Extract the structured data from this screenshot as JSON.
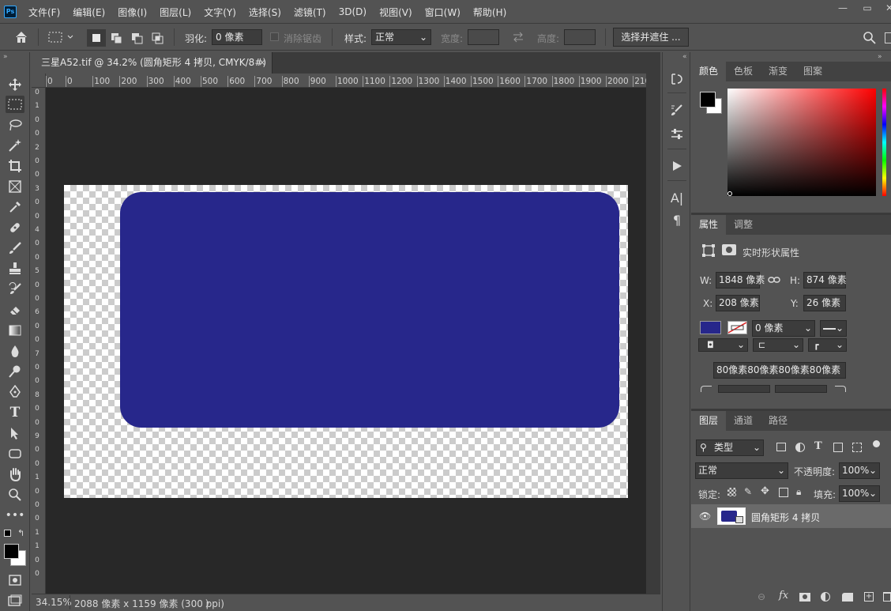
{
  "app": {
    "logo": "Ps"
  },
  "menu": [
    "文件(F)",
    "编辑(E)",
    "图像(I)",
    "图层(L)",
    "文字(Y)",
    "选择(S)",
    "滤镜(T)",
    "3D(D)",
    "视图(V)",
    "窗口(W)",
    "帮助(H)"
  ],
  "options": {
    "feather_label": "羽化:",
    "feather_value": "0 像素",
    "antialias_label": "消除锯齿",
    "style_label": "样式:",
    "style_value": "正常",
    "width_label": "宽度:",
    "height_label": "高度:",
    "select_mask_button": "选择并遮住 ..."
  },
  "document": {
    "tab_title": "三星A52.tif @ 34.2% (圆角矩形 4 拷贝, CMYK/8#)",
    "close": "×"
  },
  "ruler": {
    "h_ticks": [
      "0",
      "0",
      "100",
      "200",
      "300",
      "400",
      "500",
      "600",
      "700",
      "800",
      "900",
      "1000",
      "1100",
      "1200",
      "1300",
      "1400",
      "1500",
      "1600",
      "1700",
      "1800",
      "1900",
      "2000",
      "210"
    ],
    "v_ticks": [
      "0",
      "1",
      "0",
      "0",
      "2",
      "0",
      "0",
      "3",
      "0",
      "0",
      "4",
      "0",
      "0",
      "5",
      "0",
      "0",
      "6",
      "0",
      "0",
      "7",
      "0",
      "0",
      "8",
      "0",
      "0",
      "9",
      "0",
      "0",
      "1",
      "0",
      "0",
      "0",
      "1",
      "1",
      "0",
      "0"
    ]
  },
  "status": {
    "zoom": "34.15%",
    "doc_info": "2088 像素 x 1159 像素 (300 ppi)",
    "arrow": "〉"
  },
  "color_panel": {
    "tabs": [
      "颜色",
      "色板",
      "渐变",
      "图案"
    ],
    "fg": "#000000",
    "bg": "#ffffff",
    "hue": "#ff0000"
  },
  "properties": {
    "tabs": [
      "属性",
      "调整"
    ],
    "title": "实时形状属性",
    "w_label": "W:",
    "w_value": "1848 像素",
    "h_label": "H:",
    "h_value": "874 像素",
    "x_label": "X:",
    "x_value": "208 像素",
    "y_label": "Y:",
    "y_value": "26 像素",
    "fill_color": "#27278b",
    "stroke_width": "0 像素",
    "corner_radii": "80像素80像素80像素80像素"
  },
  "layers": {
    "tabs": [
      "图层",
      "通道",
      "路径"
    ],
    "filter_kind": "类型",
    "blend_mode": "正常",
    "opacity_label": "不透明度:",
    "opacity_value": "100%",
    "lock_label": "锁定:",
    "fill_label": "填充:",
    "fill_value": "100%",
    "items": [
      {
        "name": "圆角矩形 4 拷贝"
      }
    ]
  },
  "colors": {
    "shape": "#27278b",
    "ps_blue": "#31a8ff"
  }
}
